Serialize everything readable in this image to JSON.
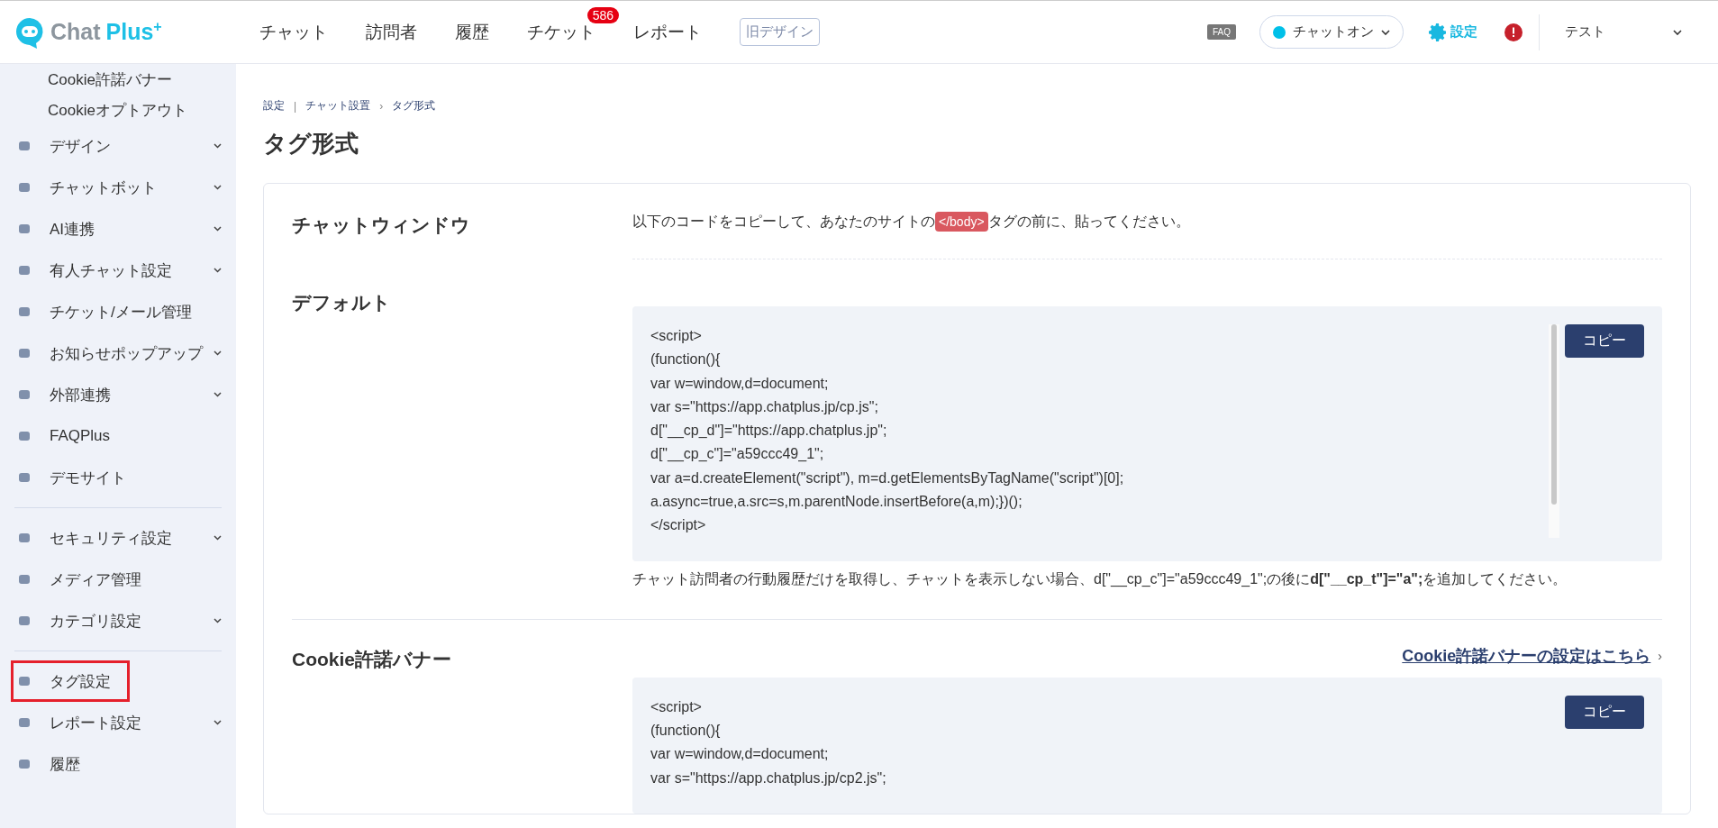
{
  "header": {
    "logo": {
      "word": "Chat",
      "accent": "Plus",
      "mark": "+"
    },
    "nav": [
      {
        "label": "チャット"
      },
      {
        "label": "訪問者"
      },
      {
        "label": "履歴"
      },
      {
        "label": "チケット",
        "badge": "586"
      },
      {
        "label": "レポート"
      }
    ],
    "old_design_button": "旧デザイン",
    "faq": "FAQ",
    "status": "チャットオン",
    "settings": "設定",
    "user": "テスト"
  },
  "sidebar": {
    "groups": [
      {
        "items": [
          {
            "kind": "subitem",
            "label": "Cookie許諾バナー",
            "submenu": false,
            "selected": false
          },
          {
            "kind": "subitem",
            "label": "Cookieオプトアウト",
            "submenu": false,
            "selected": false
          },
          {
            "kind": "item",
            "label": "デザイン",
            "submenu": true,
            "selected": false
          },
          {
            "kind": "item",
            "label": "チャットボット",
            "submenu": true,
            "selected": false
          },
          {
            "kind": "item",
            "label": "AI連携",
            "submenu": true,
            "selected": false
          },
          {
            "kind": "item",
            "label": "有人チャット設定",
            "submenu": true,
            "selected": false
          },
          {
            "kind": "item",
            "label": "チケット/メール管理",
            "submenu": false,
            "selected": false
          },
          {
            "kind": "item",
            "label": "お知らせポップアップ",
            "submenu": true,
            "selected": false
          },
          {
            "kind": "item",
            "label": "外部連携",
            "submenu": true,
            "selected": false
          },
          {
            "kind": "item",
            "label": "FAQPlus",
            "submenu": false,
            "selected": false
          },
          {
            "kind": "item",
            "label": "デモサイト",
            "submenu": false,
            "selected": false
          }
        ]
      },
      {
        "items": [
          {
            "kind": "item",
            "label": "セキュリティ設定",
            "submenu": true,
            "selected": false
          },
          {
            "kind": "item",
            "label": "メディア管理",
            "submenu": false,
            "selected": false
          },
          {
            "kind": "item",
            "label": "カテゴリ設定",
            "submenu": true,
            "selected": false
          }
        ]
      },
      {
        "items": [
          {
            "kind": "item",
            "label": "タグ設定",
            "submenu": false,
            "selected": true
          },
          {
            "kind": "item",
            "label": "レポート設定",
            "submenu": true,
            "selected": false
          },
          {
            "kind": "item",
            "label": "履歴",
            "submenu": false,
            "selected": false
          }
        ]
      }
    ]
  },
  "breadcrumb": [
    {
      "kind": "link",
      "text": "設定"
    },
    {
      "kind": "separator",
      "text": "|"
    },
    {
      "kind": "link",
      "text": "チャット設置"
    },
    {
      "kind": "separator",
      "text": "›"
    },
    {
      "kind": "current",
      "text": "タグ形式"
    }
  ],
  "title": "タグ形式",
  "sections": [
    {
      "kind": "intro",
      "label": "チャットウィンドウ",
      "text_before": "以下のコードをコピーして、あなたのサイトの",
      "tag": "</body>",
      "text_after": "タグの前に、貼ってください。"
    },
    {
      "kind": "code",
      "label": "デフォルト",
      "copy": "コピー",
      "scrollbar": true,
      "code": [
        "<script>",
        "(function(){",
        "var w=window,d=document;",
        "var s=\"https://app.chatplus.jp/cp.js\";",
        "d[\"__cp_d\"]=\"https://app.chatplus.jp\";",
        "d[\"__cp_c\"]=\"a59ccc49_1\";",
        "var a=d.createElement(\"script\"), m=d.getElementsByTagName(\"script\")[0];",
        "a.async=true,a.src=s,m.parentNode.insertBefore(a,m);})();",
        "</script>"
      ],
      "note": "チャット訪問者の行動履歴だけを取得し、チャットを表示しない場合、d[\"__cp_c\"]=\"a59ccc49_1\";の後に**d[\"__cp_t\"]=\"a\";**を追加してください。"
    },
    {
      "kind": "code",
      "label": "Cookie許諾バナー",
      "link": "Cookie許諾バナーの設定はこちら",
      "link_arrow": "›",
      "copy": "コピー",
      "scrollbar": false,
      "code": [
        "<script>",
        "(function(){",
        "var w=window,d=document;",
        "var s=\"https://app.chatplus.jp/cp2.js\";"
      ]
    }
  ]
}
